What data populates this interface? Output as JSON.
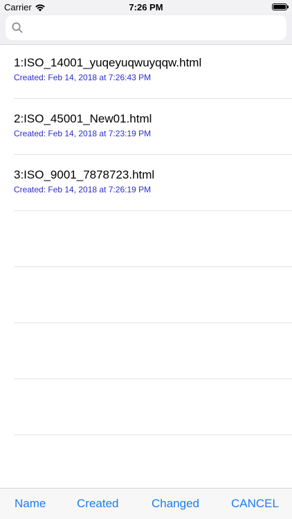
{
  "status_bar": {
    "carrier": "Carrier",
    "time": "7:26 PM",
    "wifi_icon": "wifi-icon",
    "battery_icon": "battery-icon"
  },
  "search": {
    "placeholder": "",
    "value": "",
    "icon": "search-icon"
  },
  "files": [
    {
      "name": "1:ISO_14001_yuqeyuqwuyqqw.html",
      "created": "Created: Feb 14, 2018 at 7:26:43 PM"
    },
    {
      "name": "2:ISO_45001_New01.html",
      "created": "Created: Feb 14, 2018 at 7:23:19 PM"
    },
    {
      "name": "3:ISO_9001_7878723.html",
      "created": "Created: Feb 14, 2018 at 7:26:19 PM"
    }
  ],
  "empty_rows": 5,
  "toolbar": {
    "name_label": "Name",
    "created_label": "Created",
    "changed_label": "Changed",
    "cancel_label": "CANCEL"
  },
  "colors": {
    "accent": "#1a7cf0",
    "subtitle": "#2b2bd0",
    "separator": "#e3e3e6",
    "search_bg": "#efeff4"
  }
}
